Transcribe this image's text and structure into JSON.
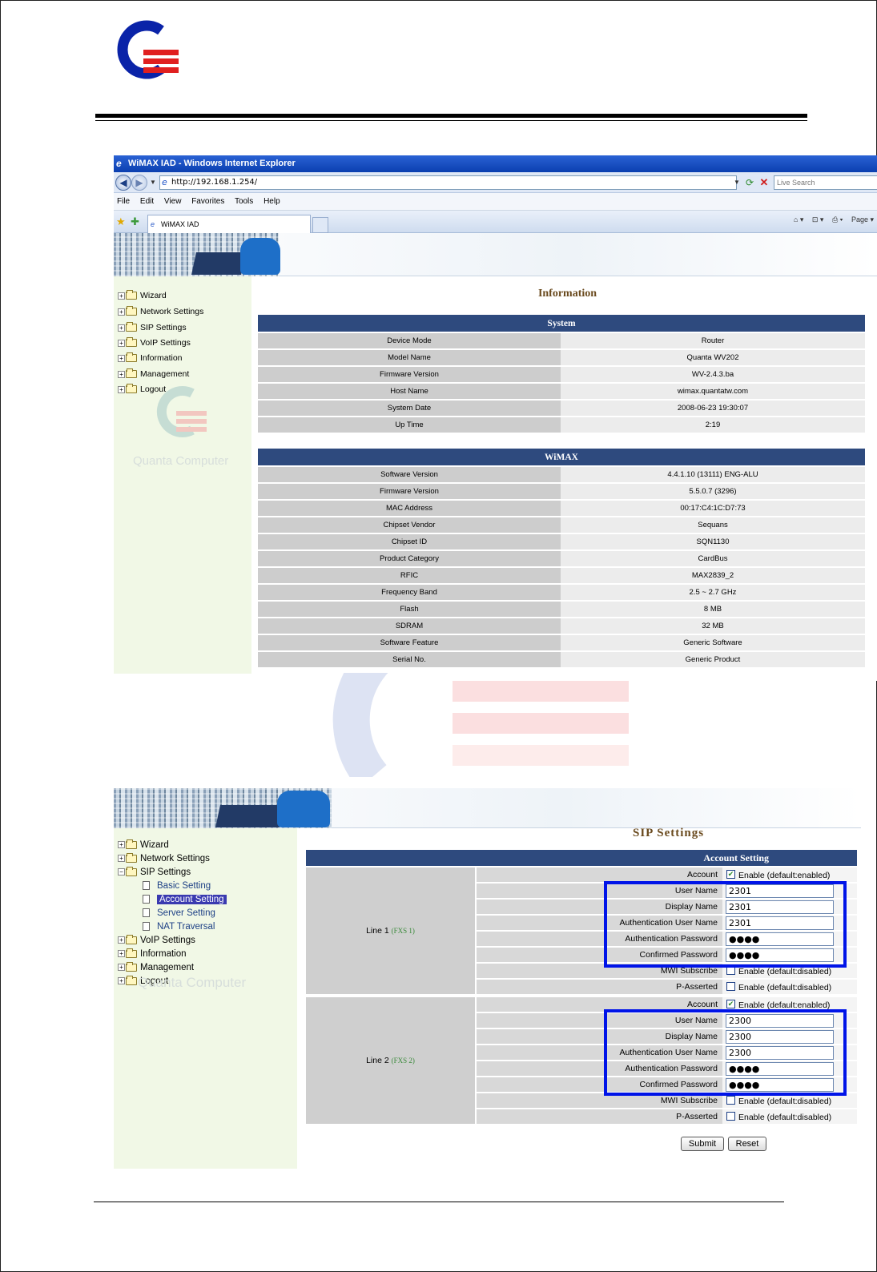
{
  "window": {
    "title": "WiMAX IAD - Windows Internet Explorer",
    "address": "http://192.168.1.254/",
    "search_placeholder": "Live Search",
    "menu": [
      "File",
      "Edit",
      "View",
      "Favorites",
      "Tools",
      "Help"
    ],
    "tab_title": "WiMAX IAD",
    "tools": [
      "⌂ ▾",
      "⊡ ▾",
      "⎙ ▾",
      "Page ▾"
    ]
  },
  "sidebar1": {
    "items": [
      "Wizard",
      "Network Settings",
      "SIP Settings",
      "VoIP Settings",
      "Information",
      "Management",
      "Logout"
    ],
    "watermark": "Quanta Computer"
  },
  "info_page": {
    "title": "Information",
    "system": {
      "header": "System",
      "rows": [
        {
          "label": "Device Mode",
          "value": "Router"
        },
        {
          "label": "Model Name",
          "value": "Quanta WV202"
        },
        {
          "label": "Firmware Version",
          "value": "WV-2.4.3.ba"
        },
        {
          "label": "Host Name",
          "value": "wimax.quantatw.com"
        },
        {
          "label": "System Date",
          "value": "2008-06-23 19:30:07"
        },
        {
          "label": "Up Time",
          "value": "2:19"
        }
      ]
    },
    "wimax": {
      "header": "WiMAX",
      "rows": [
        {
          "label": "Software Version",
          "value": "4.4.1.10 (13111) ENG-ALU"
        },
        {
          "label": "Firmware Version",
          "value": "5.5.0.7 (3296)"
        },
        {
          "label": "MAC Address",
          "value": "00:17:C4:1C:D7:73"
        },
        {
          "label": "Chipset Vendor",
          "value": "Sequans"
        },
        {
          "label": "Chipset ID",
          "value": "SQN1130"
        },
        {
          "label": "Product Category",
          "value": "CardBus"
        },
        {
          "label": "RFIC",
          "value": "MAX2839_2"
        },
        {
          "label": "Frequency Band",
          "value": "2.5 ~ 2.7 GHz"
        },
        {
          "label": "Flash",
          "value": "8 MB"
        },
        {
          "label": "SDRAM",
          "value": "32 MB"
        },
        {
          "label": "Software Feature",
          "value": "Generic Software"
        },
        {
          "label": "Serial No.",
          "value": "Generic Product"
        }
      ]
    }
  },
  "sidebar2": {
    "items": [
      "Wizard",
      "Network Settings",
      "SIP Settings",
      "Basic Setting",
      "Account Setting",
      "Server Setting",
      "NAT Traversal",
      "VoIP Settings",
      "Information",
      "Management",
      "Logout"
    ],
    "selected": "Account Setting",
    "watermark": "Quanta Computer"
  },
  "sip_page": {
    "title": "SIP Settings",
    "header": "Account Setting",
    "labels": {
      "account": "Account",
      "user_name": "User Name",
      "display_name": "Display Name",
      "auth_user": "Authentication User Name",
      "auth_pass": "Authentication Password",
      "confirm_pass": "Confirmed Password",
      "mwi": "MWI Subscribe",
      "passerted": "P-Asserted"
    },
    "enable_enabled": "Enable (default:enabled)",
    "enable_disabled": "Enable (default:disabled)",
    "lines": [
      {
        "name": "Line 1",
        "fxs": "(FXS 1)",
        "user_name": "2301",
        "display_name": "2301",
        "auth_user": "2301",
        "auth_pass": "●●●●",
        "confirm_pass": "●●●●"
      },
      {
        "name": "Line 2",
        "fxs": "(FXS 2)",
        "user_name": "2300",
        "display_name": "2300",
        "auth_user": "2300",
        "auth_pass": "●●●●",
        "confirm_pass": "●●●●"
      }
    ],
    "submit": "Submit",
    "reset": "Reset"
  },
  "colors": {
    "header_blue": "#2e4a7e",
    "sidebar_green": "#f1f8e6",
    "highlight_blue": "#0014e8",
    "logo_blue": "#0a23a8",
    "logo_red": "#e02020"
  }
}
